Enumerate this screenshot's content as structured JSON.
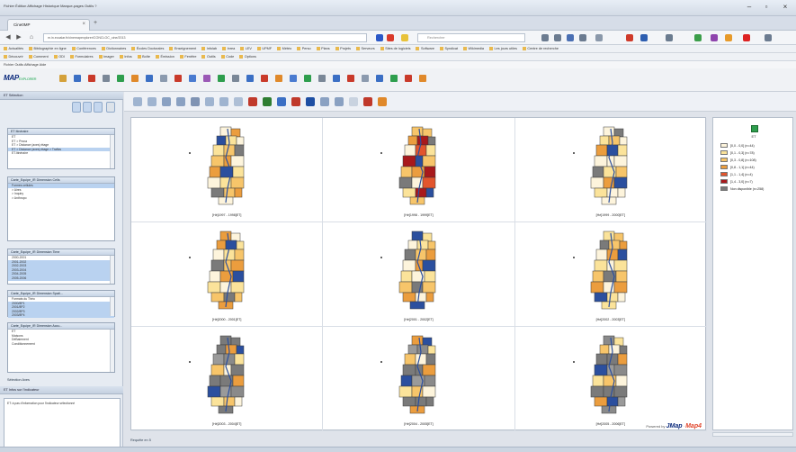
{
  "browser": {
    "menu": "Fichier  Édition  Affichage  Historique  Marque-pages  Outils  ?",
    "window_controls": [
      "–",
      "▫",
      "×"
    ],
    "tab_title": "Cine0MP",
    "tab_close": "×",
    "tab_new": "+",
    "url": "m.in.eccalar.fr/cinemapexplorer/CONCLOC_cine/2013",
    "search_placeholder": "Rechercher",
    "bookmarks_row1": [
      "Actualités",
      "Bibliographie en ligne",
      "Conférences",
      "Dictionnaires",
      "Écoles Doctorales",
      "Enseignement",
      "Infolab",
      "Inrea",
      "LEV",
      "UPMF",
      "Météo",
      "Perso",
      "Plans",
      "Projets",
      "Serveurs",
      "Sites de logiciels",
      "Software",
      "Syndicat",
      "Wikimedia",
      "Les jours utiles",
      "Centre de recherche"
    ],
    "bookmarks_row2": [
      "Découvrir",
      "Comment",
      "ODI",
      "Formulaires",
      "Imager",
      "Infos",
      "Boîte",
      "Émission",
      "Fenêtre",
      "Outils",
      "Code",
      "Options"
    ]
  },
  "app": {
    "menu": "Fichier   Outils   Affichage   Aide",
    "logo_main": "MAP",
    "logo_sub": "EXPLORER"
  },
  "left_panel": {
    "title": "ET Sélection",
    "box1": {
      "header": "ET Itinéraire",
      "rows": [
        "ET",
        "ET > Prsna",
        "ET > Distance (axes) étage",
        "ET > Distance (axes) étage > Trafics",
        "ET.Itinéraire"
      ]
    },
    "box2": {
      "header": "Carte_Equipe_IR Dimension Cells",
      "rows": [
        "Formes cellules",
        "> Aires",
        "> Inquiry",
        "> Anthropo"
      ]
    },
    "box3": {
      "header": "Carte_Equipe_IR Dimension Time",
      "rows": [
        "2000-2001",
        "2001-2002",
        "2002-2003",
        "2003-2004",
        "2004-2005",
        "2005-2006"
      ]
    },
    "box4": {
      "header": "Carte_Equipe_IR Dimension Spati...",
      "rows": [
        "Formats du Thèo",
        "2000/8P1",
        "2001/8P2",
        "2002/8P3",
        "2003/8P4"
      ]
    },
    "box5": {
      "header": "Carte_Equipe_IR Dimension Accu...",
      "rows": [
        "ET",
        "Maisons",
        "DéBaiement",
        "Conditionnement"
      ]
    },
    "tabs_label": "Sélection   Axes",
    "info_header": "ET Infos sur l'indicateur",
    "info_text": "ET: à pas d'information pour l'indicateur sélectionné"
  },
  "map_cells": [
    {
      "label": "[Hé]1997 - 1998]ET]",
      "has_map": true,
      "theme": "warm"
    },
    {
      "label": "[Hé]1998 - 1999]ET]",
      "has_map": true,
      "theme": "red"
    },
    {
      "label": "[Hé]1999 - 2000]ET]",
      "has_map": true,
      "theme": "light"
    },
    {
      "label": "[Hé]2000 - 2001]ET]",
      "has_map": true,
      "theme": "warm"
    },
    {
      "label": "[Hé]2001 - 2002]ET]",
      "has_map": true,
      "theme": "warm"
    },
    {
      "label": "[Hé]2002 - 2003]ET]",
      "has_map": true,
      "theme": "warm"
    },
    {
      "label": "[Hé]2003 - 2004]ET]",
      "has_map": true,
      "theme": "gray"
    },
    {
      "label": "[Hé]2004 - 2005]ET]",
      "has_map": true,
      "theme": "gray"
    },
    {
      "label": "[Hé]2005 - 2006]ET]",
      "has_map": true,
      "theme": "gray"
    }
  ],
  "legend": {
    "title": "ET",
    "items": [
      {
        "label": "[0,0 - 0,0]  (n=44)",
        "color": "#fdf4dc"
      },
      {
        "label": "[0,1 - 0,3]  (n=78)",
        "color": "#fbe39a"
      },
      {
        "label": "[0,3 - 0,8]  (n=108)",
        "color": "#f7c56a"
      },
      {
        "label": "[0,8 - 1,1]  (n=44)",
        "color": "#eb9d3e"
      },
      {
        "label": "[1,1 - 1,4]  (n=4)",
        "color": "#e2552d"
      },
      {
        "label": "[1,4 - 3,0]  (n=7)",
        "color": "#a8191c"
      },
      {
        "label": "Non disponible  (n=258)",
        "color": "#7a7a7a"
      }
    ]
  },
  "status": {
    "map_status": "Requête en 5",
    "powered_by": "Powered by",
    "brand1": "JMap",
    "brand2": "Map4"
  },
  "colors": {
    "palette": [
      "#fdf4dc",
      "#fbe39a",
      "#f7c56a",
      "#eb9d3e",
      "#e2552d",
      "#a8191c",
      "#7a7a7a",
      "#2b4f9e"
    ]
  }
}
